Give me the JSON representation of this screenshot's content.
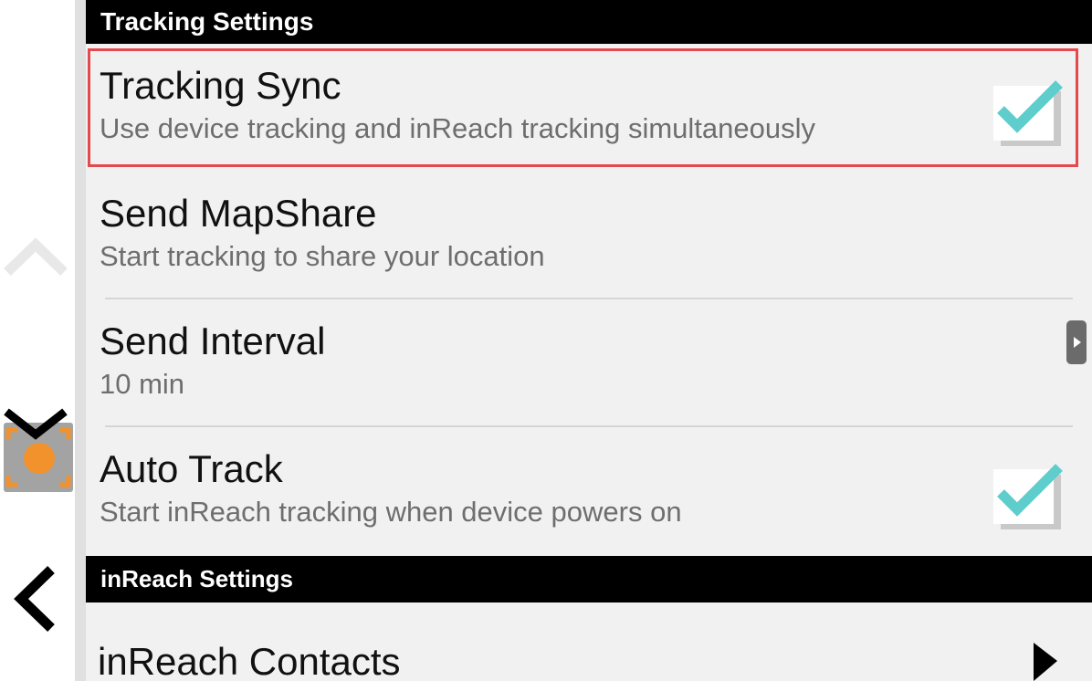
{
  "tracking_header": {
    "label": "Tracking Settings"
  },
  "settings": [
    {
      "title": "Tracking Sync",
      "subtitle": "Use device tracking and inReach tracking simultaneously",
      "checked": true
    },
    {
      "title": "Send MapShare",
      "subtitle": "Start tracking to share your location"
    },
    {
      "title": "Send Interval",
      "subtitle": "10 min"
    },
    {
      "title": "Auto Track",
      "subtitle": "Start inReach tracking when device powers on",
      "checked": true
    }
  ],
  "inreach_header": {
    "label": "inReach Settings"
  },
  "inreach_items": [
    {
      "title": "inReach Contacts"
    }
  ],
  "colors": {
    "accent_check": "#5ecdcb",
    "highlight": "#e5484d",
    "locate_orange": "#f2922d"
  },
  "icons": {
    "rail": [
      "scroll-up-icon",
      "locate-me-icon",
      "back-icon"
    ],
    "checkbox": "checkbox-checked-icon",
    "chevron": "chevron-right-icon"
  }
}
